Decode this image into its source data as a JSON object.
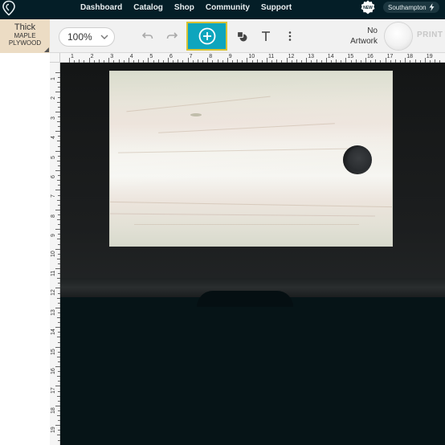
{
  "nav": {
    "links": [
      "Dashboard",
      "Catalog",
      "Shop",
      "Community",
      "Support"
    ],
    "new_badge": "NEW",
    "location": "Southampton",
    "location_icon": "lightning-icon",
    "logo_icon": "glowforge-logo-icon"
  },
  "material": {
    "thickness": "Thick",
    "name_line1": "MAPLE",
    "name_line2": "PLYWOOD"
  },
  "toolbar": {
    "zoom": "100%",
    "undo_icon": "undo-icon",
    "redo_icon": "redo-icon",
    "add_icon": "plus-circle-icon",
    "shapes_icon": "shapes-icon",
    "text_icon": "text-icon",
    "more_icon": "more-vertical-icon",
    "artwork_status_line1": "No",
    "artwork_status_line2": "Artwork",
    "print_label": "PRINT",
    "accent_color": "#0ea5bd",
    "highlight_color": "#d8c233"
  },
  "ruler": {
    "top_numbers": [
      "1",
      "2",
      "3",
      "4",
      "5",
      "6",
      "7",
      "8",
      "9",
      "10",
      "11",
      "12",
      "13",
      "14",
      "15",
      "16",
      "17",
      "18",
      "19",
      "20"
    ],
    "left_numbers": [
      "1",
      "2",
      "3",
      "4",
      "5",
      "6",
      "7",
      "8",
      "9",
      "10",
      "11",
      "12",
      "13",
      "14",
      "15",
      "16",
      "17",
      "18",
      "19"
    ]
  }
}
